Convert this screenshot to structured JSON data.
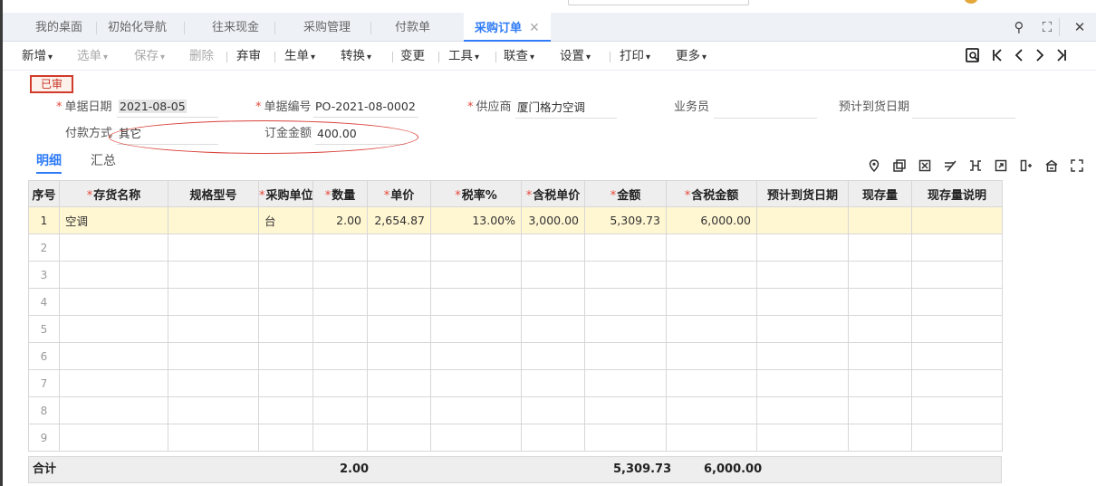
{
  "tabs": [
    {
      "label": "我的桌面"
    },
    {
      "label": "初始化导航"
    },
    {
      "label": "往来现金"
    },
    {
      "label": "采购管理"
    },
    {
      "label": "付款单"
    },
    {
      "label": "采购订单",
      "close": "✕"
    }
  ],
  "window_icons": {
    "search": "⚲",
    "maximize": "⛶",
    "close": "✕"
  },
  "toolbar": {
    "new": "新增",
    "select": "选单",
    "save": "保存",
    "delete": "删除",
    "abandon": "弃审",
    "generate": "生单",
    "convert": "转换",
    "change": "变更",
    "tools": "工具",
    "link": "联查",
    "settings": "设置",
    "print": "打印",
    "more": "更多",
    "caret": "▾"
  },
  "status_badge": "已审",
  "form": {
    "date_label": "单据日期",
    "date_value": "2021-08-05",
    "number_label": "单据编号",
    "number_value": "PO-2021-08-0002",
    "supplier_label": "供应商",
    "supplier_value": "厦门格力空调",
    "salesperson_label": "业务员",
    "salesperson_value": "",
    "expected_label": "预计到货日期",
    "expected_value": "",
    "payment_label": "付款方式",
    "payment_value": "其它",
    "deposit_label": "订金金额",
    "deposit_value": "400.00",
    "required_mark": "*"
  },
  "subtabs": {
    "detail": "明细",
    "summary": "汇总"
  },
  "grid": {
    "columns": [
      "序号",
      "存货名称",
      "规格型号",
      "采购单位",
      "数量",
      "单价",
      "税率%",
      "含税单价",
      "金额",
      "含税金额",
      "预计到货日期",
      "现存量",
      "现存量说明"
    ],
    "rows": [
      {
        "seq": "1",
        "name": "空调",
        "spec": "",
        "unit": "台",
        "qty": "2.00",
        "price": "2,654.87",
        "tax": "13.00%",
        "taxprice": "3,000.00",
        "amount": "5,309.73",
        "taxamount": "6,000.00",
        "date": "",
        "stock": "",
        "stocknote": ""
      },
      {
        "seq": "2"
      },
      {
        "seq": "3"
      },
      {
        "seq": "4"
      },
      {
        "seq": "5"
      },
      {
        "seq": "6"
      },
      {
        "seq": "7"
      },
      {
        "seq": "8"
      },
      {
        "seq": "9"
      }
    ]
  },
  "totals": {
    "label": "合计",
    "qty": "2.00",
    "amount": "5,309.73",
    "taxamount": "6,000.00"
  }
}
